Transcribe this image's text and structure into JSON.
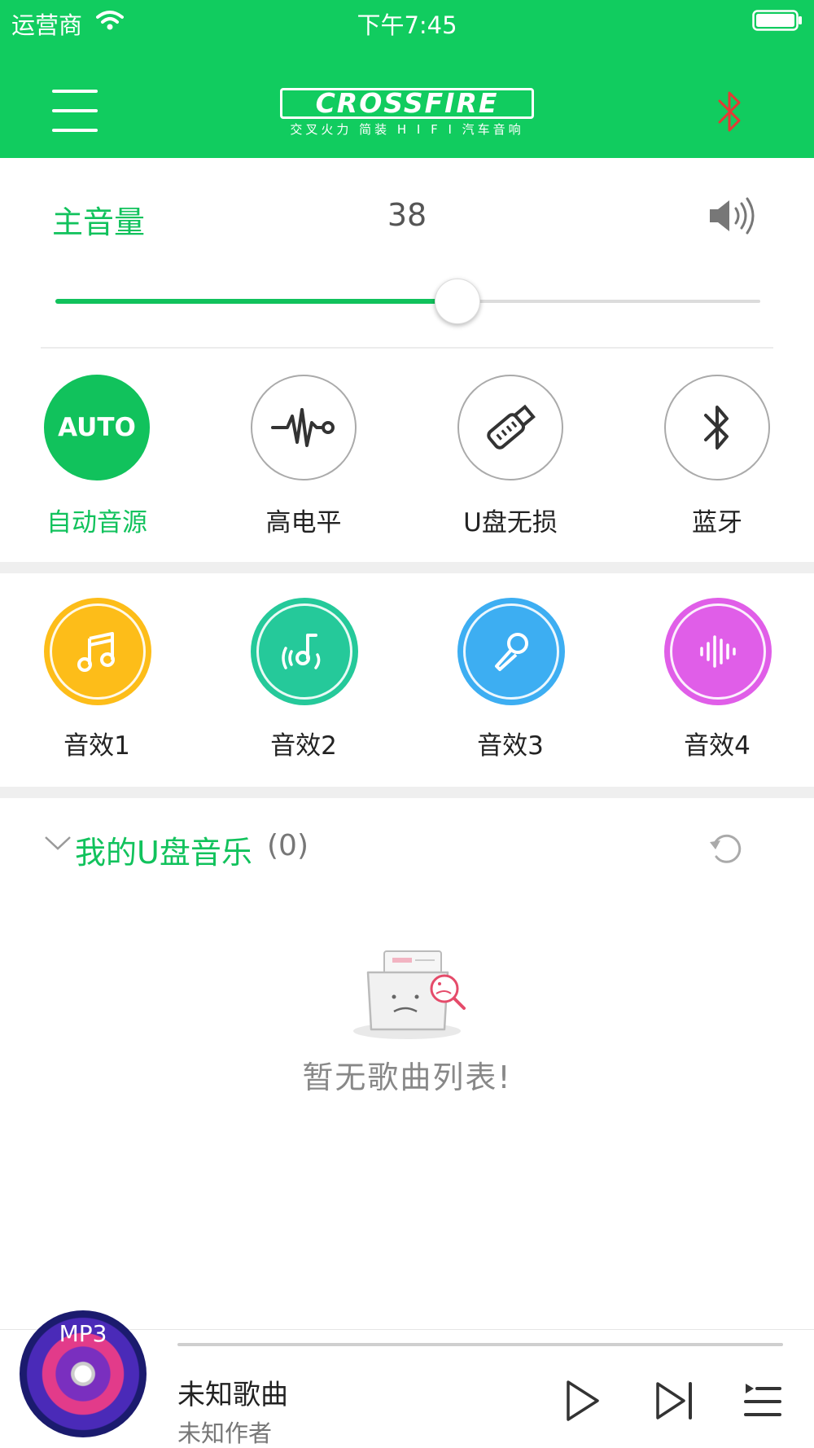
{
  "status_bar": {
    "carrier": "运营商",
    "time": "下午7:45"
  },
  "header": {
    "logo_text": "CROSSFIRE",
    "logo_subtitle": "交叉火力 简装 H I F I 汽车音响",
    "bluetooth_icon_color": "#e53935",
    "brand_color": "#11cc5f"
  },
  "volume": {
    "label": "主音量",
    "value": "38",
    "level_fraction": 0.57
  },
  "sources": [
    {
      "label": "自动音源",
      "icon": "auto-text-icon",
      "badge": "AUTO",
      "active": true
    },
    {
      "label": "高电平",
      "icon": "waveform-icon",
      "active": false
    },
    {
      "label": "U盘无损",
      "icon": "usb-drive-icon",
      "active": false
    },
    {
      "label": "蓝牙",
      "icon": "bluetooth-icon",
      "active": false
    }
  ],
  "effects": [
    {
      "label": "音效1",
      "icon": "music-note-icon",
      "color": "#fdbd19"
    },
    {
      "label": "音效2",
      "icon": "music-sound-icon",
      "color": "#25c99a"
    },
    {
      "label": "音效3",
      "icon": "microphone-icon",
      "color": "#3daef2"
    },
    {
      "label": "音效4",
      "icon": "sound-bars-icon",
      "color": "#e05ee8"
    }
  ],
  "usb_music": {
    "title": "我的U盘音乐",
    "count": "(0)",
    "empty_message": "暂无歌曲列表!"
  },
  "player": {
    "disc_label": "MP3",
    "song_title": "未知歌曲",
    "artist": "未知作者",
    "progress_fraction": 0
  }
}
